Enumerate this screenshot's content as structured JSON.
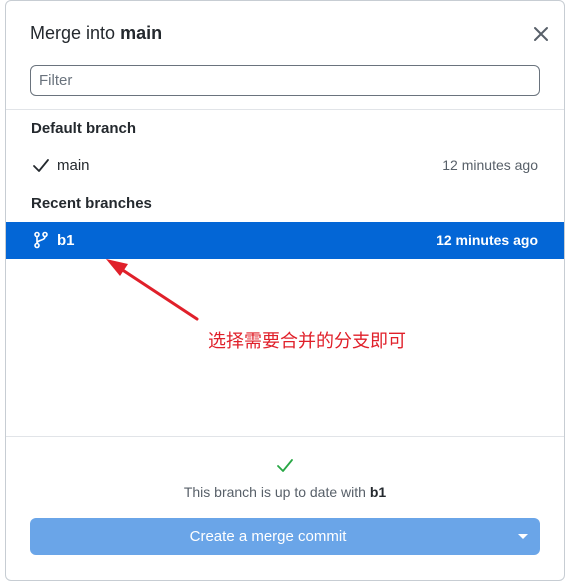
{
  "dialog": {
    "title_prefix": "Merge into",
    "title_branch": "main"
  },
  "filter": {
    "placeholder": "Filter",
    "value": ""
  },
  "sections": {
    "default_label": "Default branch",
    "recent_label": "Recent branches"
  },
  "default_branch": {
    "name": "main",
    "time": "12 minutes ago",
    "icon": "check-icon"
  },
  "recent_branches": [
    {
      "name": "b1",
      "time": "12 minutes ago",
      "icon": "git-branch-icon",
      "selected": true
    }
  ],
  "footer": {
    "status_prefix": "This branch is up to date with",
    "status_branch": "b1",
    "merge_button_label": "Create a merge commit"
  },
  "annotation": {
    "text": "选择需要合并的分支即可",
    "color": "#e0202a"
  },
  "colors": {
    "selected_row": "#0366d6",
    "merge_button": "#6aa5e8",
    "success_check": "#28a745"
  }
}
